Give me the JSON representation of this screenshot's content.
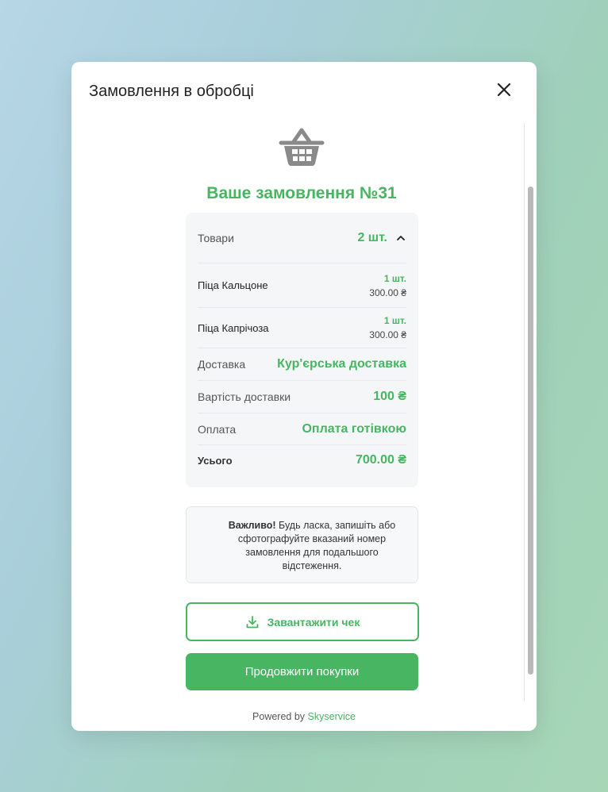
{
  "modal": {
    "title": "Замовлення в обробці",
    "close_icon": "close-icon",
    "basket_icon": "basket-icon",
    "order_heading": "Ваше замовлення №31"
  },
  "summary": {
    "items_label": "Товари",
    "items_count": "2 шт.",
    "items": [
      {
        "name": "Піца Кальцоне",
        "qty": "1 шт.",
        "price": "300.00 ₴"
      },
      {
        "name": "Піца Капрічоза",
        "qty": "1 шт.",
        "price": "300.00 ₴"
      }
    ],
    "delivery_label": "Доставка",
    "delivery_value": "Кур'єрська доставка",
    "delivery_cost_label": "Вартість доставки",
    "delivery_cost_value": "100 ₴",
    "payment_label": "Оплата",
    "payment_value": "Оплата готівкою",
    "total_label": "Усього",
    "total_value": "700.00 ₴"
  },
  "note": {
    "bold": "Важливо!",
    "text": " Будь ласка, запишіть або сфотографуйте вказаний номер замовлення для подальшого відстеження."
  },
  "buttons": {
    "download_label": "Завантажити чек",
    "download_icon": "download-icon",
    "continue_label": "Продовжити покупки"
  },
  "footer": {
    "powered_by": "Powered by",
    "brand": "Skyservice"
  },
  "colors": {
    "accent": "#48b562",
    "panel_bg": "#f5f6f8"
  }
}
